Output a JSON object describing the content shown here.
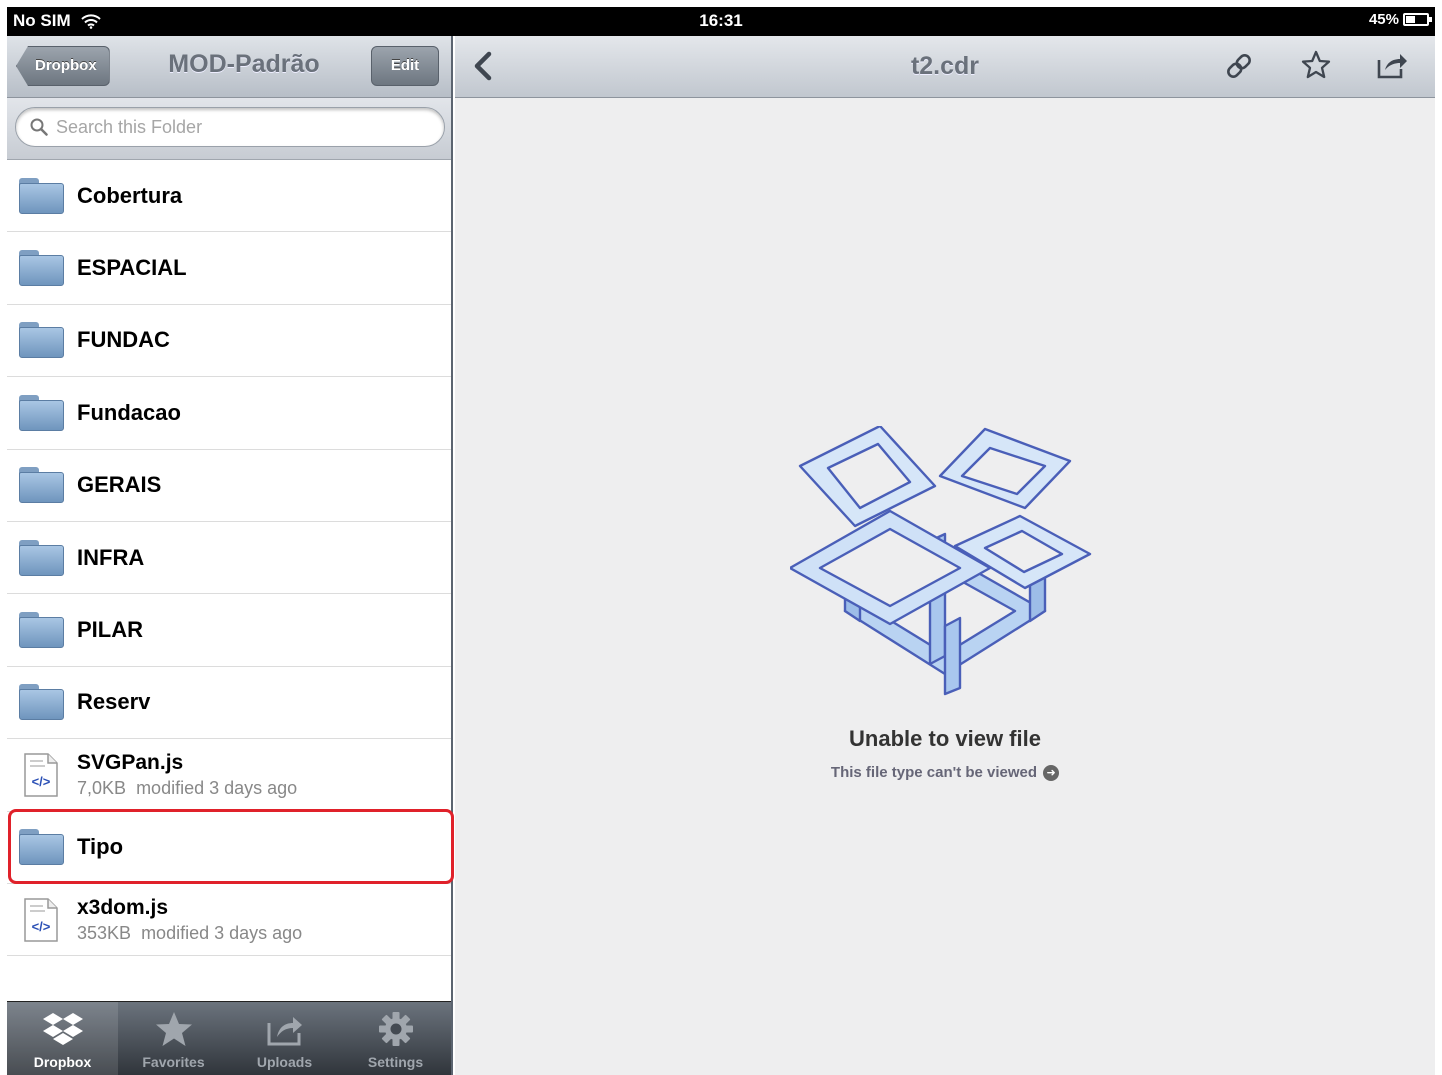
{
  "status_bar": {
    "carrier": "No SIM",
    "time": "16:31",
    "battery": "45%",
    "battery_level": 0.45
  },
  "left_nav": {
    "back_label": "Dropbox",
    "title": "MOD-Padrão",
    "edit_label": "Edit"
  },
  "search": {
    "placeholder": "Search this Folder"
  },
  "items": [
    {
      "name": "Cobertura",
      "type": "folder"
    },
    {
      "name": "ESPACIAL",
      "type": "folder"
    },
    {
      "name": "FUNDAC",
      "type": "folder"
    },
    {
      "name": "Fundacao",
      "type": "folder"
    },
    {
      "name": "GERAIS",
      "type": "folder"
    },
    {
      "name": "INFRA",
      "type": "folder"
    },
    {
      "name": "PILAR",
      "type": "folder"
    },
    {
      "name": "Reserv",
      "type": "folder"
    },
    {
      "name": "SVGPan.js",
      "type": "file",
      "size": "7,0KB",
      "modified": "modified 3 days ago"
    },
    {
      "name": "Tipo",
      "type": "folder",
      "highlighted": true
    },
    {
      "name": "x3dom.js",
      "type": "file",
      "size": "353KB",
      "modified": "modified 3 days ago"
    }
  ],
  "tab_bar": [
    {
      "label": "Dropbox",
      "icon": "dropbox-icon",
      "active": true
    },
    {
      "label": "Favorites",
      "icon": "star-icon",
      "active": false
    },
    {
      "label": "Uploads",
      "icon": "upload-icon",
      "active": false
    },
    {
      "label": "Settings",
      "icon": "gear-icon",
      "active": false
    }
  ],
  "viewer": {
    "title": "t2.cdr",
    "empty_title": "Unable to view file",
    "empty_subtitle": "This file type can't be viewed"
  },
  "colors": {
    "highlight": "#e0212a",
    "folder": "#8fb0d5",
    "box_outline": "#4a5fb8"
  }
}
